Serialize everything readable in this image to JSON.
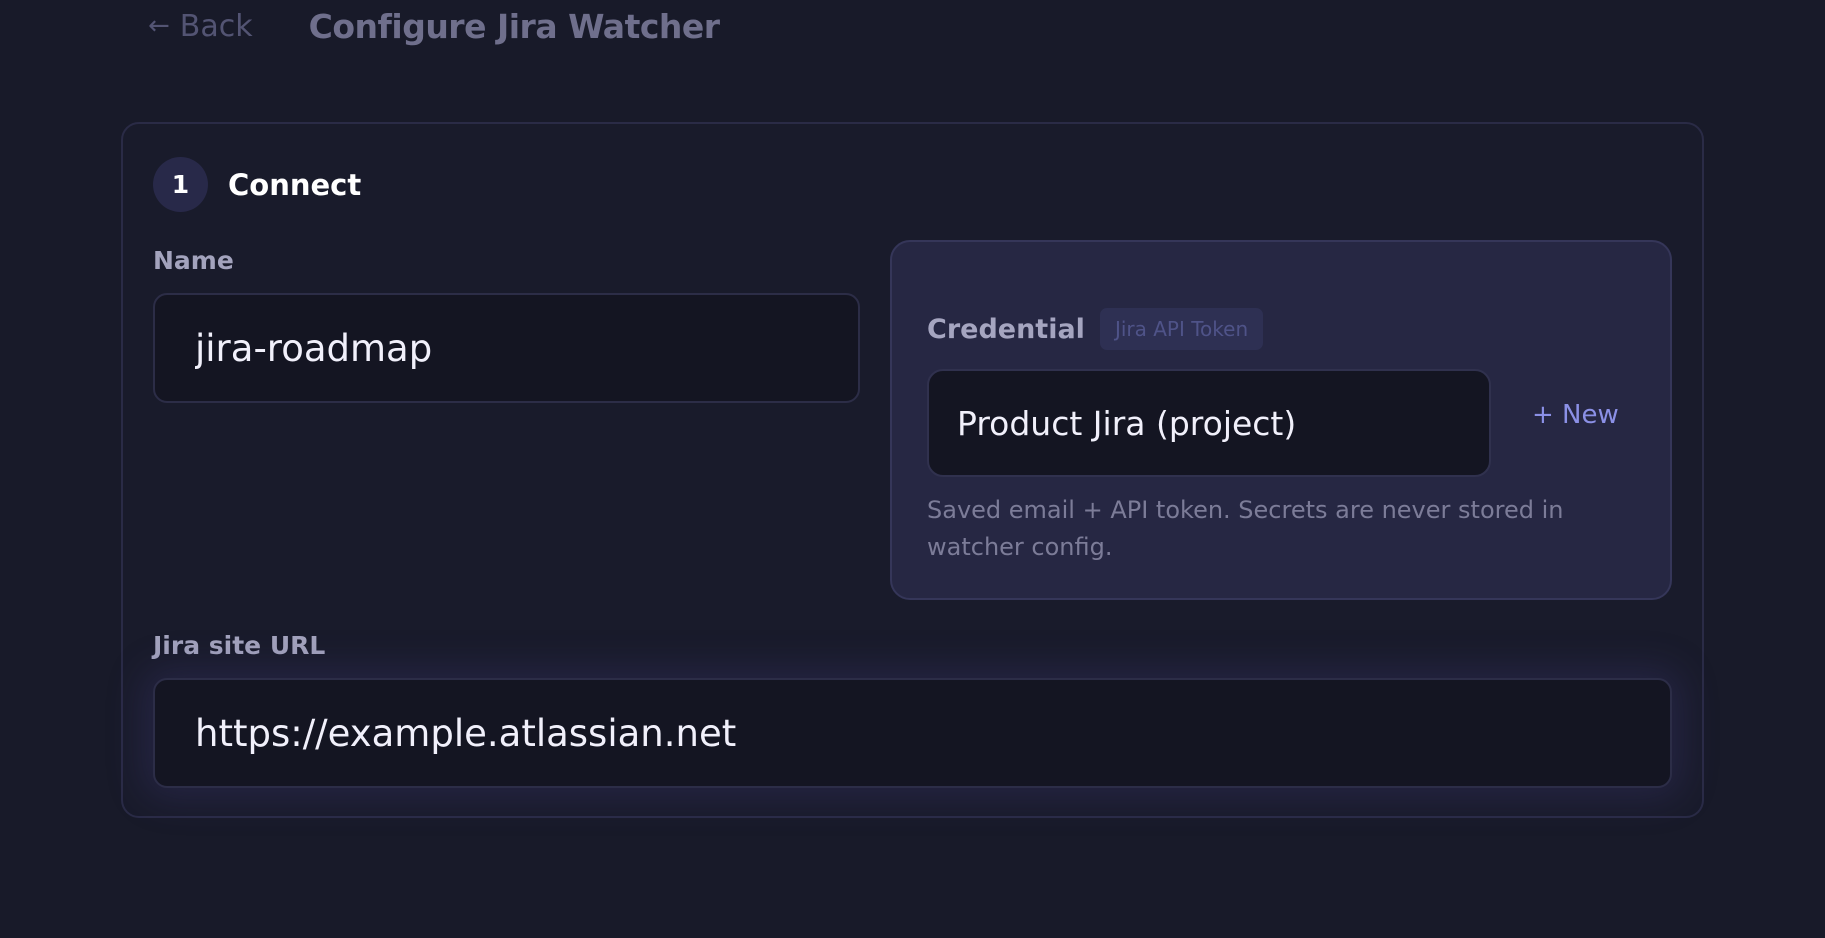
{
  "header": {
    "back_icon": "←",
    "back_label": "Back",
    "title": "Configure Jira Watcher"
  },
  "step": {
    "number": "1",
    "title": "Connect"
  },
  "name_field": {
    "label": "Name",
    "value": "jira-roadmap"
  },
  "credential": {
    "label": "Credential",
    "badge": "Jira API Token",
    "selected": "Product Jira (project)",
    "new_label": "+ New",
    "help": "Saved email + API token. Secrets are never stored in watcher config."
  },
  "url_field": {
    "label": "Jira site URL",
    "value": "https://example.atlassian.net"
  },
  "colors": {
    "background": "#181a29",
    "accent": "#8b90e6",
    "panel": "#262743"
  }
}
